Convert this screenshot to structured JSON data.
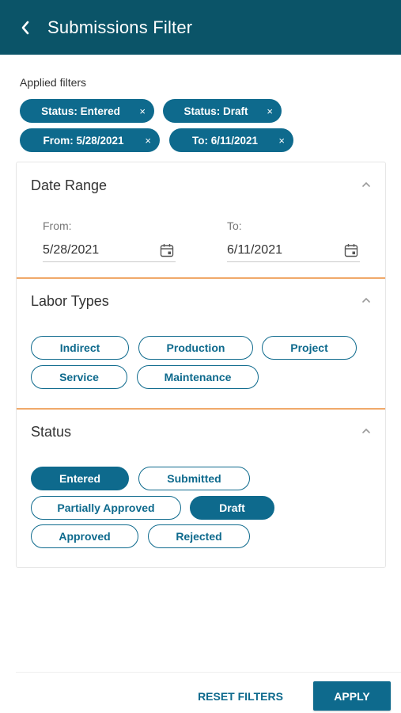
{
  "header": {
    "title": "Submissions Filter",
    "back_icon": "chevron-left-icon"
  },
  "applied": {
    "label": "Applied filters",
    "chips": [
      {
        "label": "Status: Entered",
        "remove": "×"
      },
      {
        "label": "Status: Draft",
        "remove": "×"
      },
      {
        "label": "From: 5/28/2021",
        "remove": "×"
      },
      {
        "label": "To: 6/11/2021",
        "remove": "×"
      }
    ]
  },
  "date_range": {
    "title": "Date Range",
    "from_label": "From:",
    "from_value": "5/28/2021",
    "to_label": "To:",
    "to_value": "6/11/2021"
  },
  "labor_types": {
    "title": "Labor Types",
    "options": [
      "Indirect",
      "Production",
      "Project",
      "Service",
      "Maintenance"
    ]
  },
  "status": {
    "title": "Status",
    "options": [
      {
        "label": "Entered",
        "selected": true
      },
      {
        "label": "Submitted",
        "selected": false
      },
      {
        "label": "Partially Approved",
        "selected": false
      },
      {
        "label": "Draft",
        "selected": true
      },
      {
        "label": "Approved",
        "selected": false
      },
      {
        "label": "Rejected",
        "selected": false
      }
    ]
  },
  "footer": {
    "reset_label": "RESET FILTERS",
    "apply_label": "APPLY"
  },
  "colors": {
    "header_bg": "#0b5468",
    "accent": "#0e6a8d",
    "divider": "#f0a96a"
  }
}
